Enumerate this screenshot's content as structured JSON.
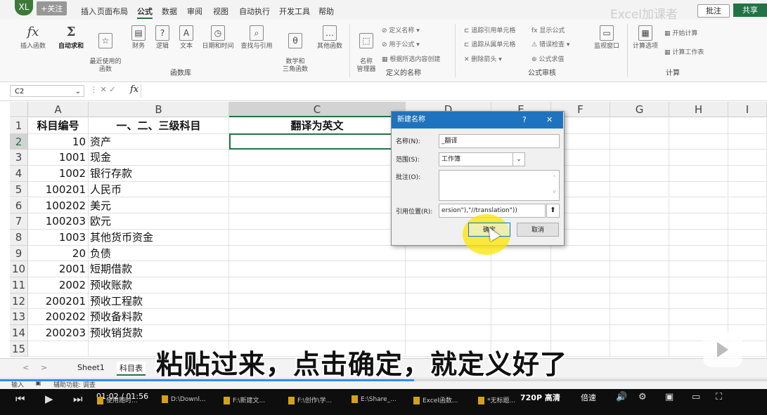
{
  "menu": {
    "avatar": "XL",
    "follow": "+关注",
    "tabs": [
      "插入",
      "页面布局",
      "公式",
      "数据",
      "审阅",
      "视图",
      "自动执行",
      "开发工具",
      "帮助"
    ],
    "active_tab": "公式",
    "watermark": "Excel加课者",
    "comment_btn": "批注",
    "share_btn": "共享"
  },
  "ribbon": {
    "insert_fn": "插入函数",
    "autosum": "自动求和",
    "recent": "最近使用的\n函数",
    "finance": "财务",
    "logic": "逻辑",
    "text": "文本",
    "datetime": "日期和时间",
    "lookup": "查找与引用",
    "math": "数学和\n三角函数",
    "other": "其他函数",
    "group_lib": "函数库",
    "name_mgr": "名称\n管理器",
    "define_name": "定义名称",
    "use_in_formula": "用于公式",
    "create_from_sel": "根据所选内容创建",
    "group_names": "定义的名称",
    "trace_prec": "追踪引用单元格",
    "trace_dep": "追踪从属单元格",
    "remove_arrows": "删除箭头",
    "show_formulas": "显示公式",
    "error_check": "错误检查",
    "eval_formula": "公式求值",
    "watch": "监视窗口",
    "group_audit": "公式审核",
    "calc_options": "计算选项",
    "calc_now": "开始计算",
    "calc_sheet": "计算工作表",
    "group_calc": "计算"
  },
  "formula_bar": {
    "name_box": "C2",
    "fx": "fx",
    "value": ""
  },
  "columns": [
    "A",
    "B",
    "C",
    "D",
    "E",
    "F",
    "G",
    "H",
    "I"
  ],
  "selected_col": "C",
  "rows": [
    {
      "n": "1",
      "a": "科目编号",
      "b": "一、二、三级科目",
      "c": "翻译为英文"
    },
    {
      "n": "2",
      "a": "10",
      "b": "资产",
      "c": ""
    },
    {
      "n": "3",
      "a": "1001",
      "b": "现金",
      "c": ""
    },
    {
      "n": "4",
      "a": "1002",
      "b": "银行存款",
      "c": ""
    },
    {
      "n": "5",
      "a": "100201",
      "b": "人民币",
      "c": ""
    },
    {
      "n": "6",
      "a": "100202",
      "b": "美元",
      "c": ""
    },
    {
      "n": "7",
      "a": "100203",
      "b": "欧元",
      "c": ""
    },
    {
      "n": "8",
      "a": "1003",
      "b": "其他货币资金",
      "c": ""
    },
    {
      "n": "9",
      "a": "20",
      "b": "负债",
      "c": ""
    },
    {
      "n": "10",
      "a": "2001",
      "b": "短期借款",
      "c": ""
    },
    {
      "n": "11",
      "a": "2002",
      "b": "预收账款",
      "c": ""
    },
    {
      "n": "12",
      "a": "200201",
      "b": "预收工程款",
      "c": ""
    },
    {
      "n": "13",
      "a": "200202",
      "b": "预收备料款",
      "c": ""
    },
    {
      "n": "14",
      "a": "200203",
      "b": "预收销货款",
      "c": ""
    },
    {
      "n": "15",
      "a": "",
      "b": "",
      "c": ""
    }
  ],
  "dialog": {
    "title": "新建名称",
    "help": "?",
    "close": "✕",
    "name_label": "名称(N):",
    "name_value": "_翻译",
    "scope_label": "范围(S):",
    "scope_value": "工作簿",
    "comment_label": "批注(O):",
    "comment_value": "",
    "ref_label": "引用位置(R):",
    "ref_value": "ersion\"),\"//translation\"))",
    "ok": "确定",
    "cancel": "取消"
  },
  "subtitle": "粘贴过来，点击确定，就定义好了",
  "sheets": {
    "tabs": [
      "Sheet1",
      "科目表"
    ],
    "active": "科目表"
  },
  "status": {
    "mode": "输入",
    "accessibility": "辅助功能: 调查"
  },
  "video": {
    "time": "01:02 / 01:56",
    "quality": "720P 高清",
    "speed": "倍速",
    "progress": 0.54
  },
  "taskbar": [
    {
      "label": "使用随时..."
    },
    {
      "label": "D:\\Downl..."
    },
    {
      "label": "F:\\新建文..."
    },
    {
      "label": "F:\\创作\\学..."
    },
    {
      "label": "E:\\Share_..."
    },
    {
      "label": "Excel函数..."
    },
    {
      "label": "*无标题..."
    }
  ]
}
